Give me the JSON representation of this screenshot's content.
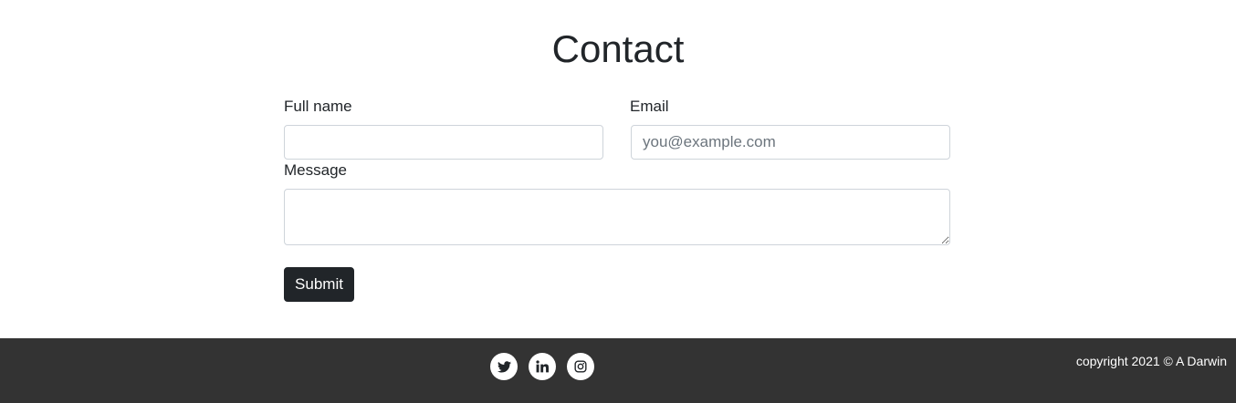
{
  "page": {
    "title": "Contact"
  },
  "form": {
    "full_name_label": "Full name",
    "full_name_value": "",
    "email_label": "Email",
    "email_value": "",
    "email_placeholder": "you@example.com",
    "message_label": "Message",
    "message_value": "",
    "submit_label": "Submit"
  },
  "footer": {
    "social": [
      "twitter-icon",
      "linkedin-icon",
      "instagram-icon"
    ],
    "copyright": "copyright 2021 © A Darwin",
    "background": "#333333"
  },
  "colors": {
    "button": "#212529",
    "text": "#212529"
  }
}
